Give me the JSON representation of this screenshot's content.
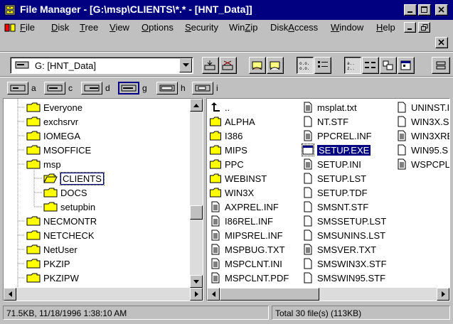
{
  "window": {
    "title": "File Manager - [G:\\msp\\CLIENTS\\*.* - [HNT_Data]]",
    "accent": "#000080"
  },
  "menu": {
    "items": [
      {
        "label": "File",
        "mnemonic": "F"
      },
      {
        "label": "Disk",
        "mnemonic": "D"
      },
      {
        "label": "Tree",
        "mnemonic": "T"
      },
      {
        "label": "View",
        "mnemonic": "V"
      },
      {
        "label": "Options",
        "mnemonic": "O"
      },
      {
        "label": "Security",
        "mnemonic": "S"
      },
      {
        "label": "WinZip",
        "mnemonic": "Z"
      },
      {
        "label": "DiskAccess",
        "mnemonic": "A"
      },
      {
        "label": "Window",
        "mnemonic": "W"
      },
      {
        "label": "Help",
        "mnemonic": "H"
      }
    ]
  },
  "toolbar": {
    "drive_selector": "G: [HNT_Data]"
  },
  "drives": [
    {
      "letter": "a",
      "selected": false
    },
    {
      "letter": "c",
      "selected": false
    },
    {
      "letter": "d",
      "selected": false
    },
    {
      "letter": "g",
      "selected": true
    },
    {
      "letter": "h",
      "selected": false
    },
    {
      "letter": "i",
      "selected": false
    }
  ],
  "tree": {
    "items": [
      {
        "label": "Everyone",
        "level": 0,
        "open": false
      },
      {
        "label": "exchsrvr",
        "level": 0,
        "open": false
      },
      {
        "label": "IOMEGA",
        "level": 0,
        "open": false
      },
      {
        "label": "MSOFFICE",
        "level": 0,
        "open": false
      },
      {
        "label": "msp",
        "level": 0,
        "open": true
      },
      {
        "label": "CLIENTS",
        "level": 1,
        "open": true,
        "selected": true
      },
      {
        "label": "DOCS",
        "level": 1,
        "open": false
      },
      {
        "label": "setupbin",
        "level": 1,
        "open": false
      },
      {
        "label": "NECMONTR",
        "level": 0,
        "open": false
      },
      {
        "label": "NETCHECK",
        "level": 0,
        "open": false
      },
      {
        "label": "NetUser",
        "level": 0,
        "open": false
      },
      {
        "label": "PKZIP",
        "level": 0,
        "open": false
      },
      {
        "label": "PKZIPW",
        "level": 0,
        "open": false
      }
    ]
  },
  "files": {
    "columns": [
      [
        {
          "name": "..",
          "type": "up"
        },
        {
          "name": "ALPHA",
          "type": "folder"
        },
        {
          "name": "I386",
          "type": "folder"
        },
        {
          "name": "MIPS",
          "type": "folder"
        },
        {
          "name": "PPC",
          "type": "folder"
        },
        {
          "name": "WEBINST",
          "type": "folder"
        },
        {
          "name": "WIN3X",
          "type": "folder"
        },
        {
          "name": "AXPREL.INF",
          "type": "doc"
        },
        {
          "name": "I86REL.INF",
          "type": "doc"
        },
        {
          "name": "MIPSREL.INF",
          "type": "doc"
        },
        {
          "name": "MSPBUG.TXT",
          "type": "doc"
        },
        {
          "name": "MSPCLNT.INI",
          "type": "doc"
        },
        {
          "name": "MSPCLNT.PDF",
          "type": "doc"
        }
      ],
      [
        {
          "name": "msplat.txt",
          "type": "doc"
        },
        {
          "name": "NT.STF",
          "type": "file"
        },
        {
          "name": "PPCREL.INF",
          "type": "doc"
        },
        {
          "name": "SETUP.EXE",
          "type": "exe",
          "selected": true
        },
        {
          "name": "SETUP.INI",
          "type": "doc"
        },
        {
          "name": "SETUP.LST",
          "type": "file"
        },
        {
          "name": "SETUP.TDF",
          "type": "file"
        },
        {
          "name": "SMSNT.STF",
          "type": "file"
        },
        {
          "name": "SMSSETUP.LST",
          "type": "file"
        },
        {
          "name": "SMSUNINS.LST",
          "type": "file"
        },
        {
          "name": "SMSVER.TXT",
          "type": "doc"
        },
        {
          "name": "SMSWIN3X.STF",
          "type": "file"
        },
        {
          "name": "SMSWIN95.STF",
          "type": "file"
        }
      ],
      [
        {
          "name": "UNINST.I",
          "type": "file"
        },
        {
          "name": "WIN3X.S",
          "type": "file"
        },
        {
          "name": "WIN3XRE",
          "type": "doc"
        },
        {
          "name": "WIN95.S",
          "type": "file"
        },
        {
          "name": "WSPCPL",
          "type": "doc"
        }
      ]
    ]
  },
  "status": {
    "left": "71.5KB, 11/18/1996 1:38:10 AM",
    "right": "Total 30 file(s) (113KB)"
  }
}
